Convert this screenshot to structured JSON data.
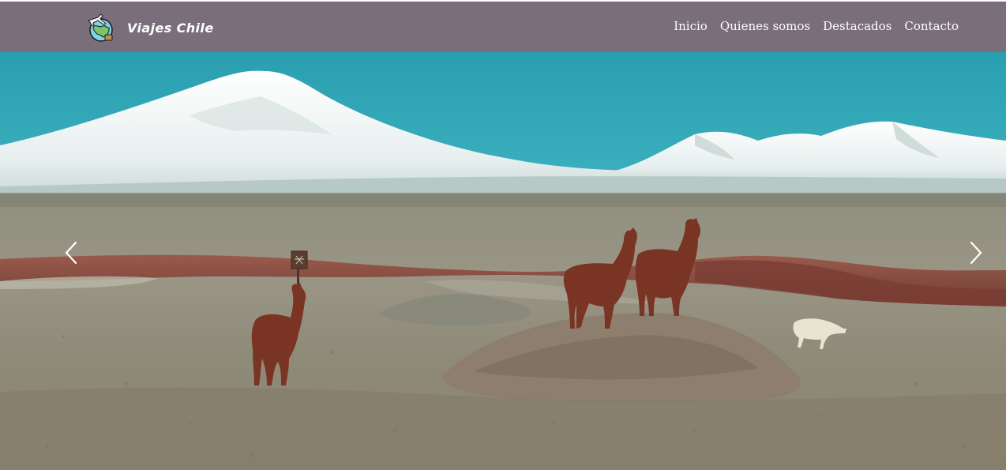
{
  "brand": {
    "name": "Viajes Chile",
    "logo_icon": "travel-globe-icon"
  },
  "nav": {
    "items": [
      {
        "label": "Inicio"
      },
      {
        "label": "Quienes somos"
      },
      {
        "label": "Destacados"
      },
      {
        "label": "Contacto"
      }
    ]
  },
  "carousel": {
    "prev_icon": "chevron-left-icon",
    "next_icon": "chevron-right-icon",
    "sign_icon": "wooden-sign-icon"
  },
  "colors": {
    "navbar": "#7a6e7b",
    "sky": "#2fa4b4",
    "text": "#ffffff"
  }
}
